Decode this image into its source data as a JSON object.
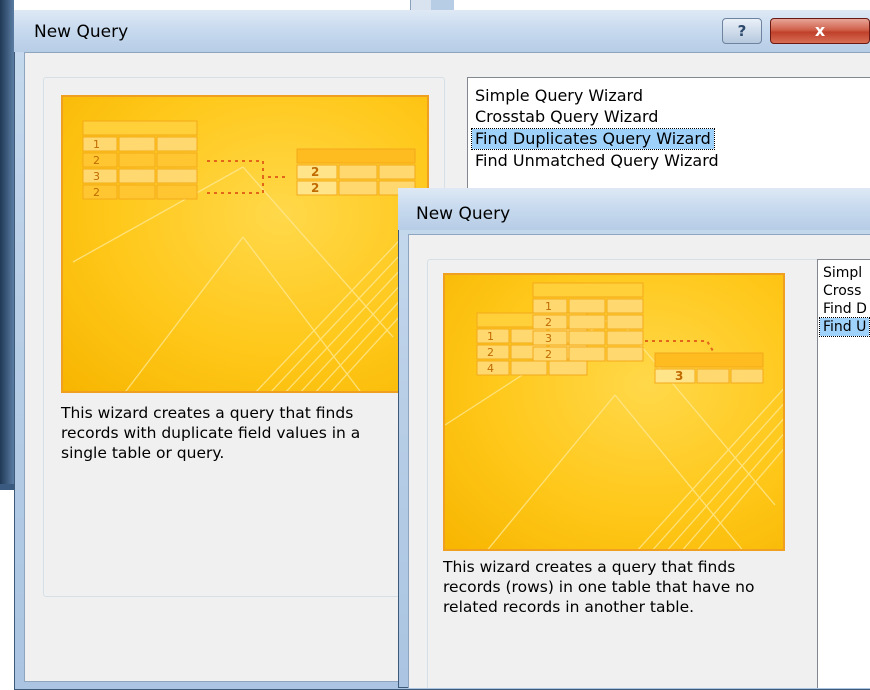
{
  "dialog_back": {
    "title": "New Query",
    "help_label": "?",
    "close_label": "x",
    "description": "This wizard creates a query that finds records with duplicate field values in a single table or query.",
    "wizards": [
      {
        "label": "Simple Query Wizard",
        "selected": false
      },
      {
        "label": "Crosstab Query Wizard",
        "selected": false
      },
      {
        "label": "Find Duplicates Query Wizard",
        "selected": true
      },
      {
        "label": "Find Unmatched Query Wizard",
        "selected": false
      }
    ],
    "illustration": {
      "left_table_numbers": [
        "1",
        "2",
        "3",
        "2"
      ],
      "right_table_numbers": [
        "2",
        "2"
      ]
    }
  },
  "dialog_front": {
    "title": "New Query",
    "description": "This wizard creates a query that finds records (rows) in one table that have no related records in another table.",
    "wizards": [
      {
        "label": "Simpl",
        "selected": false
      },
      {
        "label": "Cross",
        "selected": false
      },
      {
        "label": "Find D",
        "selected": false
      },
      {
        "label": "Find U",
        "selected": true
      }
    ],
    "illustration": {
      "table_a_numbers": [
        "1",
        "2",
        "4"
      ],
      "table_b_numbers": [
        "1",
        "2",
        "3",
        "2"
      ],
      "result_number": "3"
    }
  },
  "colors": {
    "preview_fill": "#ffc81a",
    "preview_border": "#f0a020",
    "selection": "#9fd2fb",
    "title_bar": "#c6d9ee"
  }
}
